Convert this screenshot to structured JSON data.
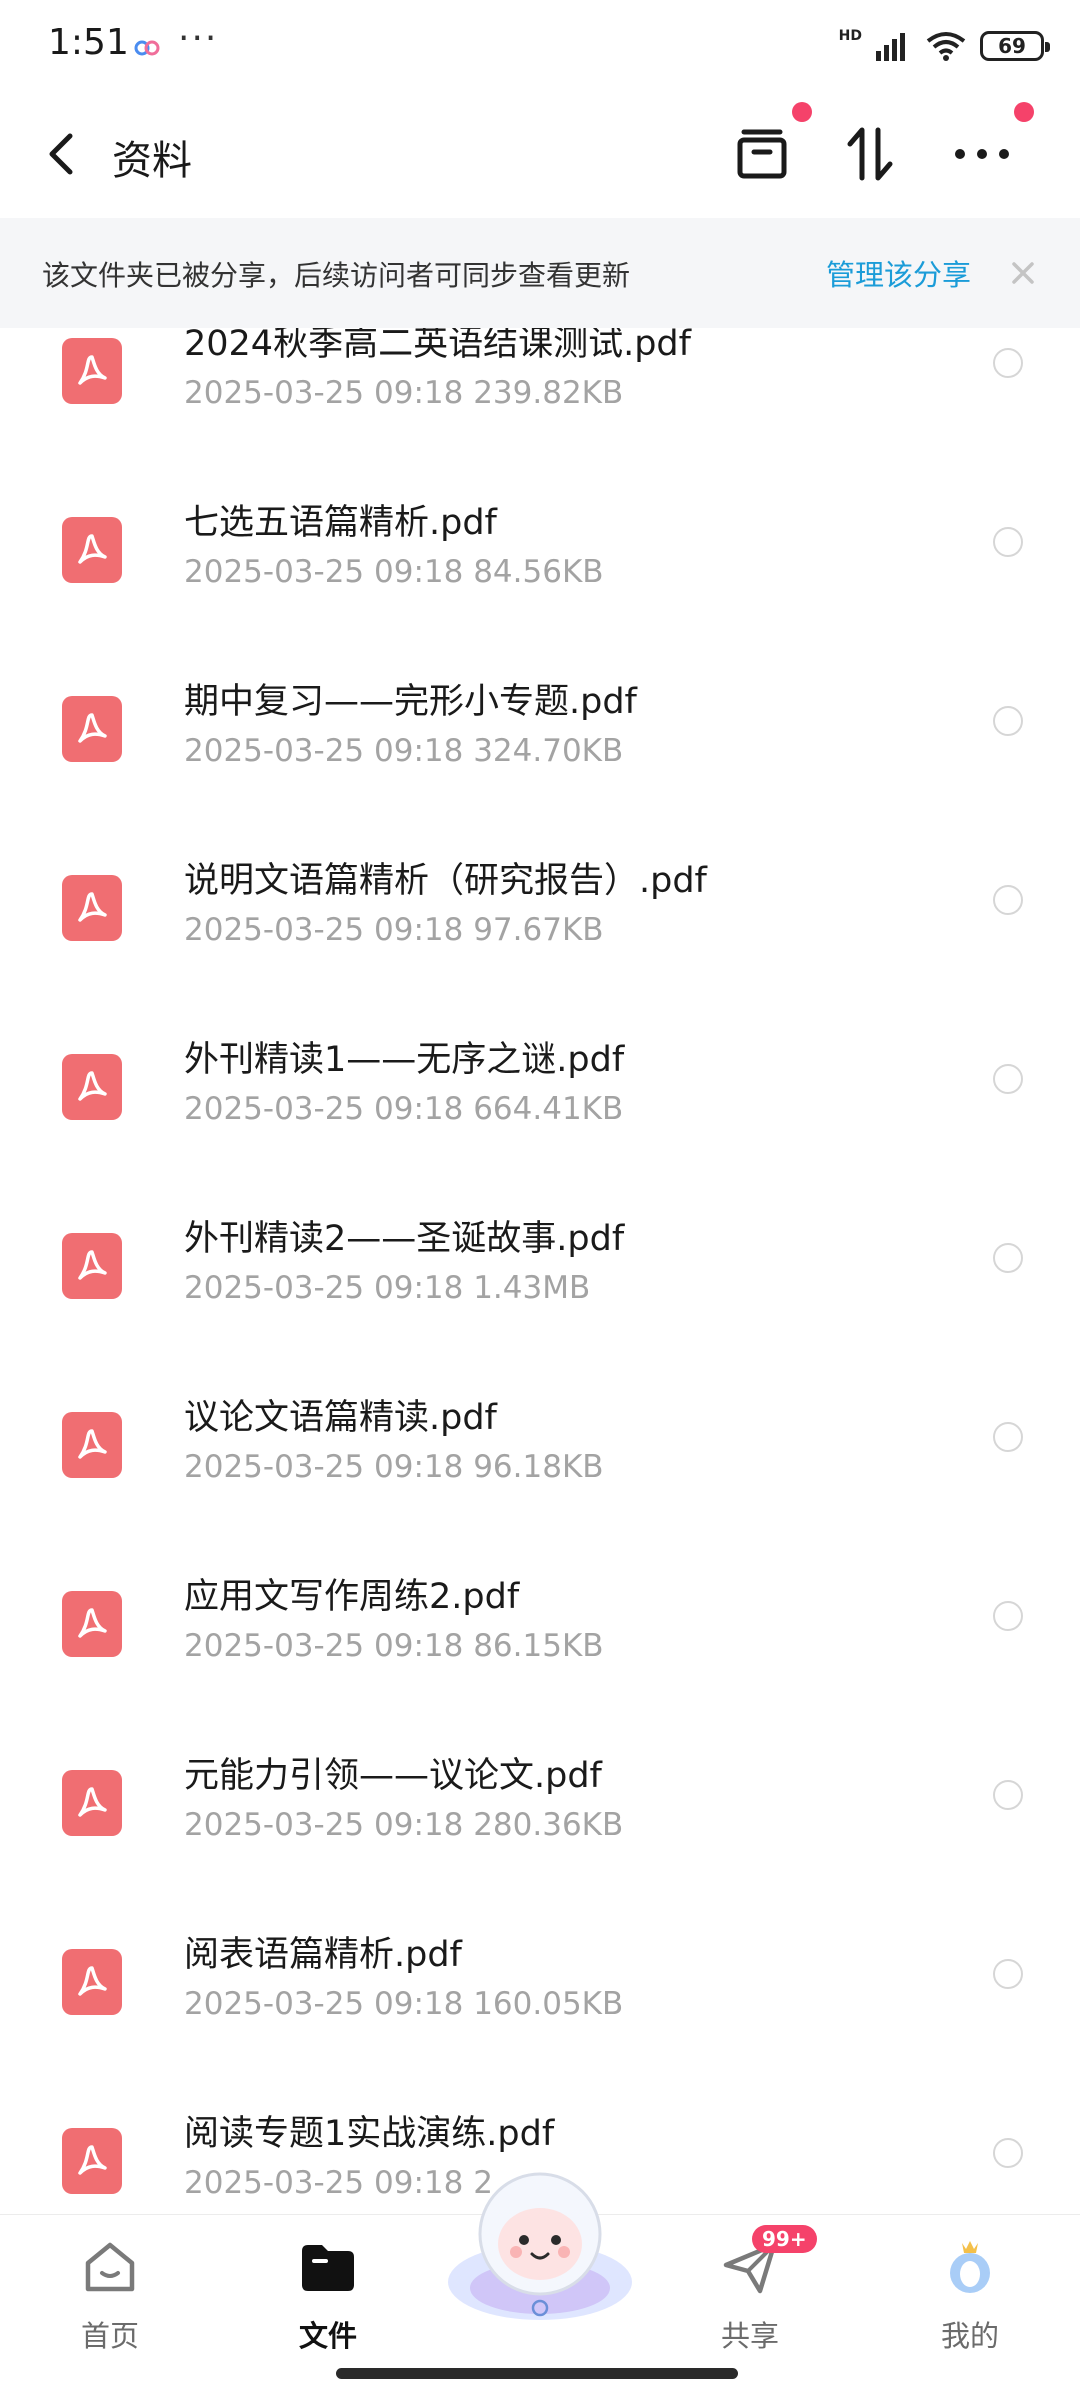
{
  "status_bar": {
    "time": "1:51",
    "dots": "···",
    "network": "HD",
    "battery": "69"
  },
  "header": {
    "title": "资料"
  },
  "banner": {
    "text": "该文件夹已被分享，后续访问者可同步查看更新",
    "link": "管理该分享",
    "link_color": "#1b9cd8"
  },
  "files": [
    {
      "name": "2024秋季高二英语结课测试.pdf",
      "meta": "2025-03-25  09:18  239.82KB"
    },
    {
      "name": "七选五语篇精析.pdf",
      "meta": "2025-03-25  09:18  84.56KB"
    },
    {
      "name": "期中复习——完形小专题.pdf",
      "meta": "2025-03-25  09:18  324.70KB"
    },
    {
      "name": "说明文语篇精析（研究报告）.pdf",
      "meta": "2025-03-25  09:18  97.67KB"
    },
    {
      "name": "外刊精读1——无序之谜.pdf",
      "meta": "2025-03-25  09:18  664.41KB"
    },
    {
      "name": "外刊精读2——圣诞故事.pdf",
      "meta": "2025-03-25  09:18  1.43MB"
    },
    {
      "name": "议论文语篇精读.pdf",
      "meta": "2025-03-25  09:18  96.18KB"
    },
    {
      "name": "应用文写作周练2.pdf",
      "meta": "2025-03-25  09:18  86.15KB"
    },
    {
      "name": "元能力引领——议论文.pdf",
      "meta": "2025-03-25  09:18  280.36KB"
    },
    {
      "name": "阅表语篇精析.pdf",
      "meta": "2025-03-25  09:18  160.05KB"
    },
    {
      "name": "阅读专题1实战演练.pdf",
      "meta": "2025-03-25  09:18  2"
    }
  ],
  "bottom_nav": {
    "home": "首页",
    "files": "文件",
    "share": "共享",
    "share_badge": "99+",
    "mine": "我的"
  },
  "colors": {
    "pdf_icon": "#f06e72",
    "badge": "#f5426a",
    "accent": "#1b9cd8"
  }
}
